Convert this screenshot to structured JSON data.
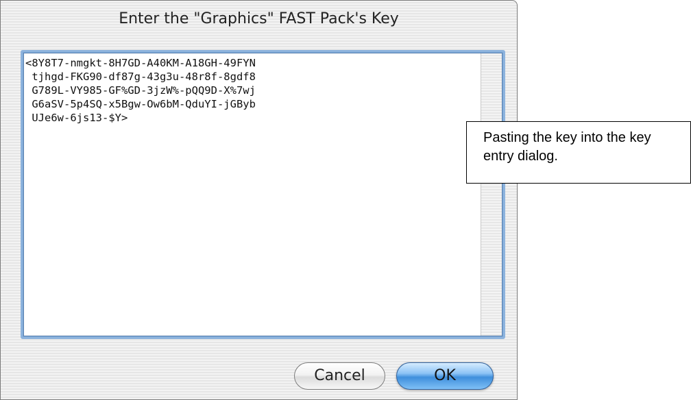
{
  "dialog": {
    "title": "Enter the \"Graphics\" FAST Pack's Key",
    "key_text": "<8Y8T7-nmgkt-8H7GD-A40KM-A18GH-49FYN\n tjhgd-FKG90-df87g-43g3u-48r8f-8gdf8\n G789L-VY985-GF%GD-3jzW%-pQQ9D-X%7wj\n G6aSV-5p4SQ-x5Bgw-Ow6bM-QduYI-jGByb\n UJe6w-6js13-$Y>",
    "cancel_label": "Cancel",
    "ok_label": "OK"
  },
  "callout": {
    "text": "Pasting the key into the key entry dialog."
  }
}
